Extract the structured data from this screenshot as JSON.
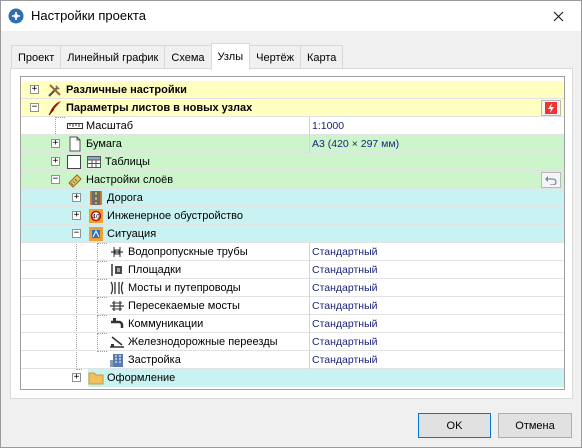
{
  "window": {
    "title": "Настройки проекта"
  },
  "tabs": [
    {
      "label": "Проект"
    },
    {
      "label": "Линейный график"
    },
    {
      "label": "Схема"
    },
    {
      "label": "Узлы",
      "active": true
    },
    {
      "label": "Чертёж"
    },
    {
      "label": "Карта"
    }
  ],
  "tree": {
    "misc": {
      "label": "Различные настройки"
    },
    "sheet_params": {
      "label": "Параметры листов в новых узлах"
    },
    "scale": {
      "label": "Масштаб",
      "value": "1:1000"
    },
    "paper": {
      "label": "Бумага",
      "value": "А3 (420 × 297 мм)"
    },
    "tables": {
      "label": "Таблицы"
    },
    "layers": {
      "label": "Настройки слоёв"
    },
    "road": {
      "label": "Дорога"
    },
    "engineering": {
      "label": "Инженерное обустройство"
    },
    "situation": {
      "label": "Ситуация"
    },
    "situation_items": [
      {
        "label": "Водопропускные трубы",
        "value": "Стандартный"
      },
      {
        "label": "Площадки",
        "value": "Стандартный"
      },
      {
        "label": "Мосты и путепроводы",
        "value": "Стандартный"
      },
      {
        "label": "Пересекаемые мосты",
        "value": "Стандартный"
      },
      {
        "label": "Коммуникации",
        "value": "Стандартный"
      },
      {
        "label": "Железнодорожные переезды",
        "value": "Стандартный"
      },
      {
        "label": "Застройка",
        "value": "Стандартный"
      }
    ],
    "design": {
      "label": "Оформление"
    }
  },
  "buttons": {
    "ok": "OK",
    "cancel": "Отмена"
  },
  "colors": {
    "yellow_row": "#ffffc0",
    "green_row": "#ccf5cc",
    "cyan_row": "#c9f3f3",
    "value_text": "#1a237e"
  }
}
